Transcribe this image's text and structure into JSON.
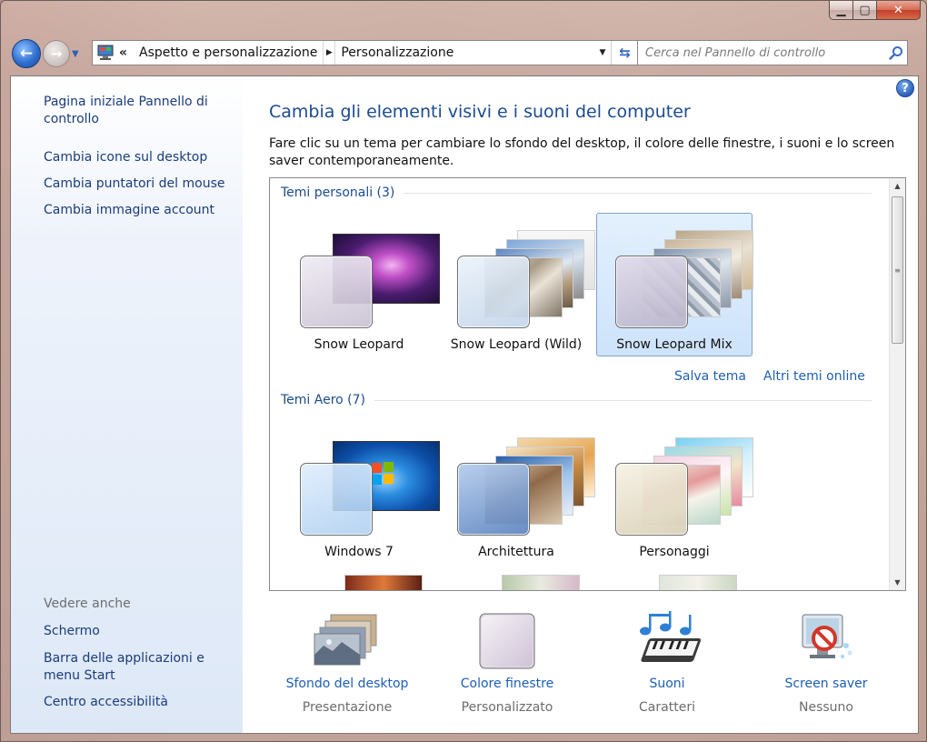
{
  "window": {
    "caption": {
      "minimize": "▁",
      "maximize": "▢",
      "close": "✕"
    }
  },
  "address_bar": {
    "overflow": "«",
    "crumbs": [
      "Aspetto e personalizzazione",
      "Personalizzazione"
    ],
    "search_placeholder": "Cerca nel Pannello di controllo"
  },
  "sidebar": {
    "home_link": "Pagina iniziale Pannello di controllo",
    "links": [
      "Cambia icone sul desktop",
      "Cambia puntatori del mouse",
      "Cambia immagine account"
    ],
    "see_also_title": "Vedere anche",
    "see_also": [
      "Schermo",
      "Barra delle applicazioni e menu Start",
      "Centro accessibilità"
    ]
  },
  "main": {
    "title": "Cambia gli elementi visivi e i suoni del computer",
    "description": "Fare clic su un tema per cambiare lo sfondo del desktop, il colore delle finestre, i suoni e lo screen saver contemporaneamente."
  },
  "themes": {
    "groups": [
      {
        "header": "Temi personali (3)",
        "items": [
          {
            "label": "Snow Leopard",
            "selected": false
          },
          {
            "label": "Snow Leopard (Wild)",
            "selected": false
          },
          {
            "label": "Snow Leopard Mix",
            "selected": true
          }
        ]
      },
      {
        "header": "Temi Aero (7)",
        "items": [
          {
            "label": "Windows 7",
            "selected": false
          },
          {
            "label": "Architettura",
            "selected": false
          },
          {
            "label": "Personaggi",
            "selected": false
          }
        ]
      }
    ],
    "save_link": "Salva tema",
    "online_link": "Altri temi online"
  },
  "options": [
    {
      "name": "Sfondo del desktop",
      "value": "Presentazione",
      "icon": "desktop-background-icon"
    },
    {
      "name": "Colore finestre",
      "value": "Personalizzato",
      "icon": "window-color-icon"
    },
    {
      "name": "Suoni",
      "value": "Caratteri",
      "icon": "sounds-icon"
    },
    {
      "name": "Screen saver",
      "value": "Nessuno",
      "icon": "screen-saver-icon"
    }
  ],
  "colors": {
    "link": "#1e5fb4",
    "heading": "#1c4b8f",
    "selection": "#cde3fb"
  }
}
